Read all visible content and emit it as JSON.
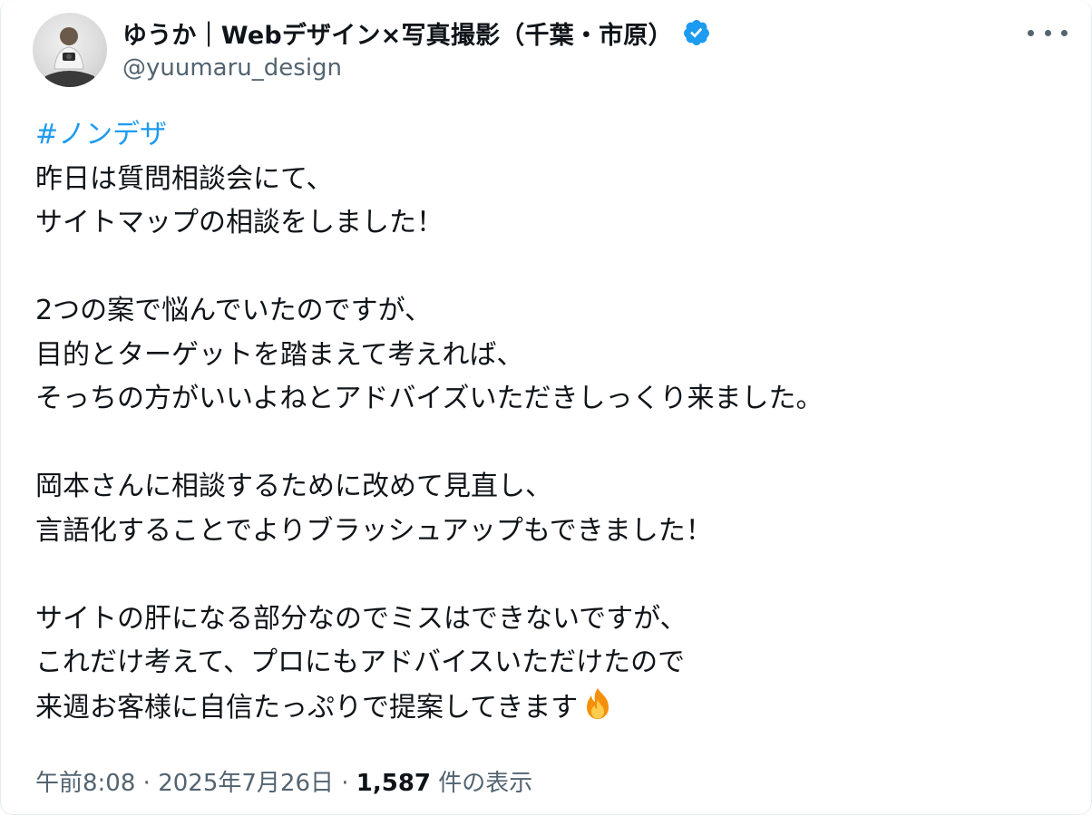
{
  "author": {
    "display_name": "ゆうか｜Webデザイン×写真撮影（千葉・市原）",
    "handle": "@yuumaru_design",
    "verified": true
  },
  "tweet": {
    "hashtag": "#ノンデザ",
    "lines": [
      "昨日は質問相談会にて、",
      "サイトマップの相談をしました！",
      "",
      "2つの案で悩んでいたのですが、",
      "目的とターゲットを踏まえて考えれば、",
      "そっちの方がいいよねとアドバイズいただきしっくり来ました。",
      "",
      "岡本さんに相談するために改めて見直し、",
      "言語化することでよりブラッシュアップもできました！",
      "",
      "サイトの肝になる部分なのでミスはできないですが、",
      "これだけ考えて、プロにもアドバイスいただけたので",
      "来週お客様に自信たっぷりで提案してきます"
    ],
    "trailing_emoji": "fire-emoji"
  },
  "meta": {
    "time": "午前8:08",
    "separator": "·",
    "date": "2025年7月26日",
    "views_count": "1,587",
    "views_label": "件の表示"
  },
  "colors": {
    "hashtag": "#1d9bf0",
    "verified_badge": "#1d9bf0",
    "secondary_text": "#536471"
  }
}
